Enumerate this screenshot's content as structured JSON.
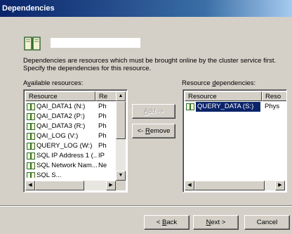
{
  "window": {
    "title": "Dependencies"
  },
  "header": {
    "resource_name": ""
  },
  "description": {
    "line1": "Dependencies are resources which must be brought online by the cluster service first.",
    "line2": "Specify the dependencies for this resource."
  },
  "available": {
    "label_pre": "A",
    "label_u": "v",
    "label_post": "ailable resources:",
    "columns": [
      "Resource",
      "Re"
    ],
    "rows": [
      {
        "name": "QAI_DATA1 (N:)",
        "type": "Ph"
      },
      {
        "name": "QAI_DATA2 (P:)",
        "type": "Ph"
      },
      {
        "name": "QAI_DATA3 (R:)",
        "type": "Ph"
      },
      {
        "name": "QAI_LOG (V:)",
        "type": "Ph"
      },
      {
        "name": "QUERY_LOG (W:)",
        "type": "Ph"
      },
      {
        "name": "SQL IP Address 1 (...",
        "type": "IP"
      },
      {
        "name": "SQL Network Nam...",
        "type": "Ne"
      },
      {
        "name": "SQL S...",
        "type": ""
      }
    ]
  },
  "dependencies": {
    "label_pre": "Resource ",
    "label_u": "d",
    "label_post": "ependencies:",
    "columns": [
      "Resource",
      "Reso"
    ],
    "rows": [
      {
        "name": "QUERY_DATA (S:)",
        "type": "Phys"
      }
    ]
  },
  "buttons": {
    "add_pre": "",
    "add_u": "A",
    "add_post": "dd ->",
    "remove_pre": "<- ",
    "remove_u": "R",
    "remove_post": "emove",
    "back_pre": "< ",
    "back_u": "B",
    "back_post": "ack",
    "next_pre": "",
    "next_u": "N",
    "next_post": "ext >",
    "cancel": "Cancel"
  },
  "colors": {
    "title_start": "#0a246a",
    "title_end": "#a6caf0",
    "face": "#d4d0c8",
    "selection": "#0a246a"
  },
  "icons": {
    "resource": "cluster-resource-icon",
    "header": "cluster-resource-large-icon"
  }
}
